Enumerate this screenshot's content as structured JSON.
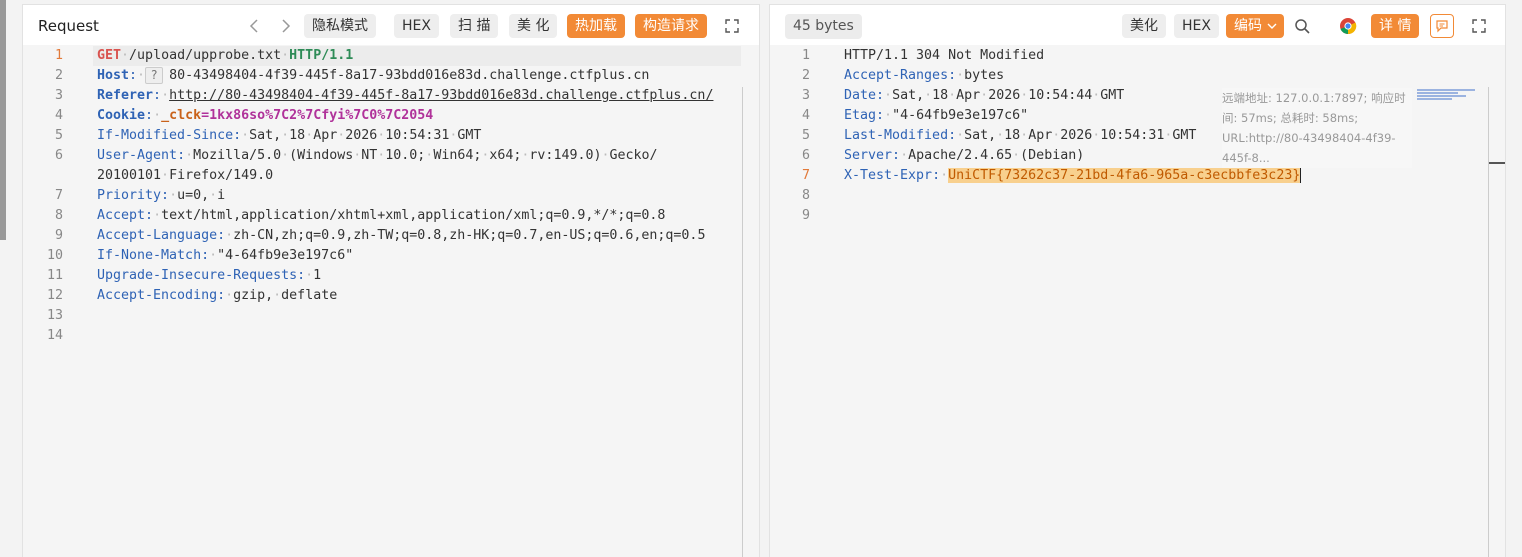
{
  "request": {
    "title": "Request",
    "buttons": {
      "privacy": "隐私模式",
      "hex": "HEX",
      "scan": "扫 描",
      "beautify": "美 化",
      "hotload": "热加载",
      "build": "构造请求"
    },
    "lines": [
      {
        "n": "1"
      },
      {
        "n": "2"
      },
      {
        "n": "3"
      },
      {
        "n": "4"
      },
      {
        "n": "5"
      },
      {
        "n": "6"
      },
      {
        "n": "7"
      },
      {
        "n": "8"
      },
      {
        "n": "9"
      },
      {
        "n": "10"
      },
      {
        "n": "11"
      },
      {
        "n": "12"
      },
      {
        "n": "13"
      },
      {
        "n": "14"
      }
    ],
    "method": "GET",
    "path": "/upload/upprobe.txt",
    "version": "HTTP/1.1",
    "host_key": "Host",
    "host_q": "?",
    "host_val": "80-43498404-4f39-445f-8a17-93bdd016e83d.challenge.ctfplus.cn",
    "referer_key": "Referer",
    "referer_val": "http://80-43498404-4f39-445f-8a17-93bdd016e83d.challenge.ctfplus.cn/",
    "cookie_key": "Cookie",
    "cookie_name": "_clck",
    "cookie_eq": "=",
    "cookie_val": "1kx86so%7C2%7Cfyi%7C0%7C2054",
    "ims_key": "If-Modified-Since",
    "ims_val": "Sat, 18 Apr 2026 10:54:31 GMT",
    "ua_key": "User-Agent",
    "ua_val1": "Mozilla/5.0 (Windows NT 10.0; Win64; x64; rv:149.0) Gecko/",
    "ua_val2": "20100101 Firefox/149.0",
    "prio_key": "Priority",
    "prio_val": "u=0, i",
    "accept_key": "Accept",
    "accept_val": "text/html,application/xhtml+xml,application/xml;q=0.9,*/*;q=0.8",
    "al_key": "Accept-Language",
    "al_val": "zh-CN,zh;q=0.9,zh-TW;q=0.8,zh-HK;q=0.7,en-US;q=0.6,en;q=0.5",
    "inm_key": "If-None-Match",
    "inm_val": "\"4-64fb9e3e197c6\"",
    "uir_key": "Upgrade-Insecure-Requests",
    "uir_val": "1",
    "ae_key": "Accept-Encoding",
    "ae_val": "gzip, deflate"
  },
  "response": {
    "size": "45 bytes",
    "buttons": {
      "beautify": "美化",
      "hex": "HEX",
      "encode": "编码",
      "details": "详 情"
    },
    "tooltip": "远端地址: 127.0.0.1:7897; 响应时间: 57ms; 总耗时: 58ms; URL:http://80-43498404-4f39-445f-8...",
    "status_line": "HTTP/1.1 304 Not Modified",
    "ar_key": "Accept-Ranges",
    "ar_val": "bytes",
    "date_key": "Date",
    "date_val": "Sat, 18 Apr 2026 10:54:44 GMT",
    "etag_key": "Etag",
    "etag_val": "\"4-64fb9e3e197c6\"",
    "lm_key": "Last-Modified",
    "lm_val": "Sat, 18 Apr 2026 10:54:31 GMT",
    "server_key": "Server",
    "server_val": "Apache/2.4.65 (Debian)",
    "xt_key": "X-Test-Expr",
    "xt_val": "UniCTF{73262c37-21bd-4fa6-965a-c3ecbbfe3c23}",
    "lines": [
      {
        "n": "1"
      },
      {
        "n": "2"
      },
      {
        "n": "3"
      },
      {
        "n": "4"
      },
      {
        "n": "5"
      },
      {
        "n": "6"
      },
      {
        "n": "7"
      },
      {
        "n": "8"
      },
      {
        "n": "9"
      }
    ]
  },
  "colors": {
    "accent": "#f28a36",
    "header_key": "#2f63b5",
    "method": "#d9534f",
    "highlight": "#f8d08e"
  },
  "icons": [
    "chevron-left-icon",
    "chevron-right-icon",
    "expand-icon",
    "search-icon",
    "chrome-icon",
    "comment-icon"
  ]
}
